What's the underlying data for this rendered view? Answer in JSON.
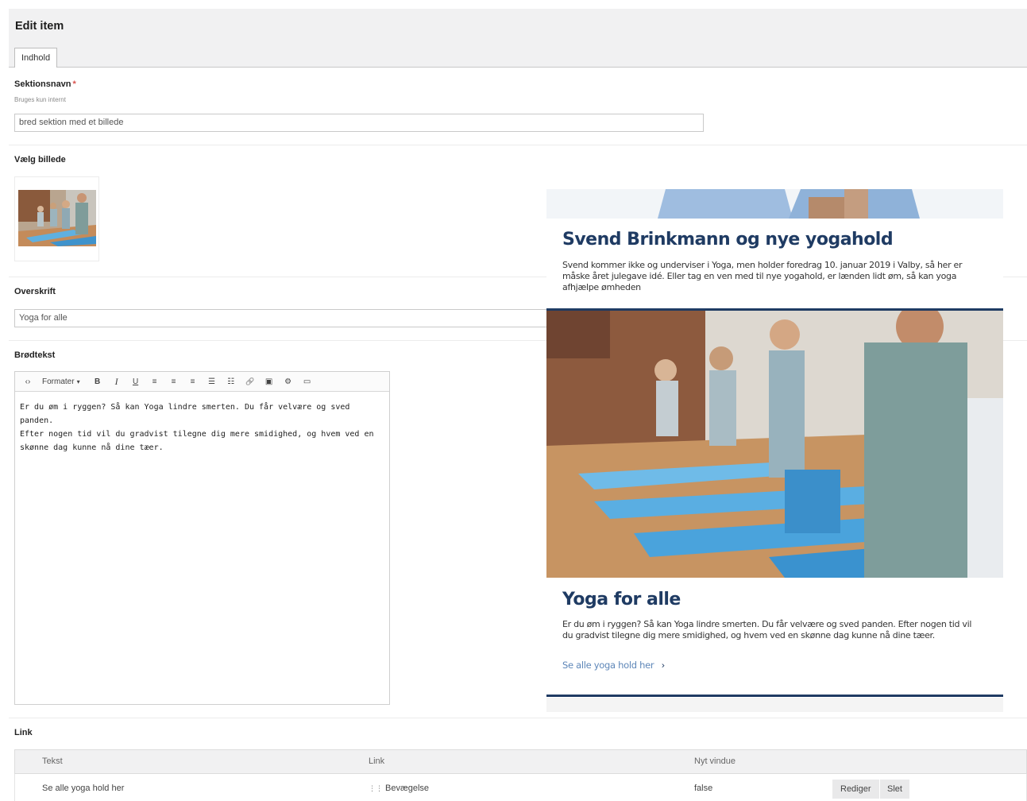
{
  "header": {
    "title": "Edit item",
    "tab_label": "Indhold"
  },
  "fields": {
    "section_name": {
      "label": "Sektionsnavn",
      "required_mark": "*",
      "help": "Bruges kun internt",
      "value": "bred sektion med et billede"
    },
    "image": {
      "label": "Vælg billede"
    },
    "heading": {
      "label": "Overskrift",
      "value": "Yoga for alle"
    },
    "body": {
      "label": "Brødtekst",
      "format_label": "Formater",
      "format_caret": "▾",
      "content": "Er du øm i ryggen? Så kan Yoga lindre smerten. Du får velvære og sved panden.\nEfter nogen tid vil du gradvist tilegne dig mere smidighed, og hvem ved en\nskønne dag kunne nå dine tæer."
    },
    "link": {
      "label": "Link"
    }
  },
  "toolbar": {
    "code_glyph": "‹›",
    "bold_glyph": "B",
    "italic_glyph": "I",
    "underline_glyph": "U",
    "align_left_glyph": "≡",
    "align_center_glyph": "≡",
    "align_right_glyph": "≡",
    "bullet_list_glyph": "☰",
    "number_list_glyph": "☷",
    "link_glyph": "🔗",
    "image_glyph": "▣",
    "macro_glyph": "⚙",
    "embed_glyph": "▭"
  },
  "preview": {
    "card1_title": "Svend Brinkmann og nye yogahold",
    "card1_text": "Svend kommer ikke og underviser i Yoga, men holder foredrag 10. januar 2019 i Valby, så her er måske året julegave idé. Eller tag en ven med til nye yogahold, er lænden lidt øm, så kan yoga afhjælpe ømheden",
    "card2_title": "Yoga for alle",
    "card2_text": "Er du øm i ryggen? Så kan Yoga lindre smerten. Du får velvære og sved panden. Efter nogen tid vil du gradvist tilegne dig mere smidighed, og hvem ved en skønne dag kunne nå dine tæer.",
    "card2_link": "Se alle yoga hold her",
    "card2_link_arrow": "›"
  },
  "link_table": {
    "headers": [
      "Tekst",
      "Link",
      "Nyt vindue"
    ],
    "rows": [
      {
        "text": "Se alle yoga hold her",
        "link_icon": "⋮⋮",
        "link": "Bevægelse",
        "new_window": "false",
        "edit_label": "Rediger",
        "delete_label": "Slet"
      }
    ]
  },
  "colors": {
    "heading_navy": "#1f3b63",
    "link_blue": "#5d86b8",
    "required_red": "#d9534f",
    "mat_blue": "#4aa3dc"
  }
}
